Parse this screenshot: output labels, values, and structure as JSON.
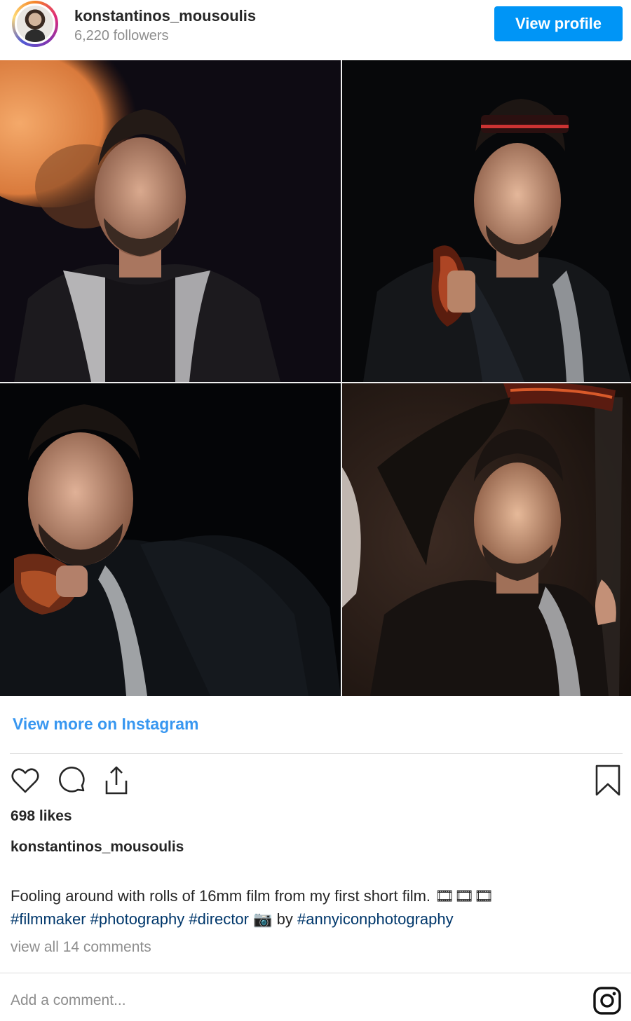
{
  "header": {
    "username": "konstantinos_mousoulis",
    "followers": "6,220 followers",
    "view_profile_label": "View profile"
  },
  "photos": [
    {
      "name": "photo-portrait-bokeh"
    },
    {
      "name": "photo-film-headband"
    },
    {
      "name": "photo-film-chin"
    },
    {
      "name": "photo-film-overhead"
    }
  ],
  "links": {
    "view_more": "View more on Instagram"
  },
  "actions": {
    "like_icon": "heart-icon",
    "comment_icon": "comment-icon",
    "share_icon": "share-icon",
    "save_icon": "bookmark-icon"
  },
  "post": {
    "likes": "698 likes",
    "caption_user": "konstantinos_mousoulis",
    "caption_line1": "Fooling around with rolls of 16mm film from my first short film. 🎞🎞🎞",
    "caption_line2_hashtags": "#filmmaker #photography #director",
    "caption_line2_emoji": "📷",
    "caption_line2_by": "by",
    "caption_line2_credit": "#annyiconphotography",
    "view_comments": "view all 14 comments"
  },
  "comment": {
    "placeholder": "Add a comment..."
  },
  "colors": {
    "accent_button": "#0095f6",
    "link": "#3897f0",
    "hashtag": "#00376b",
    "muted": "#8e8e8e"
  }
}
